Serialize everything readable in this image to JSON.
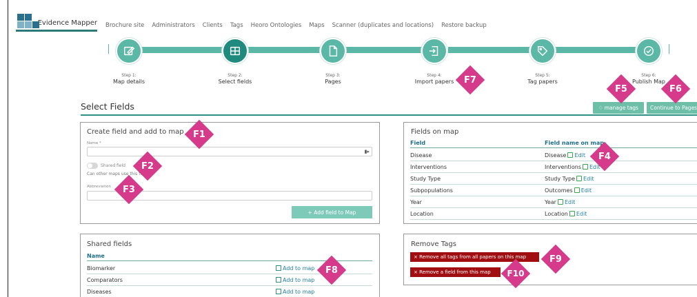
{
  "brand": {
    "name": "Evidence Mapper"
  },
  "nav": [
    "Brochure site",
    "Administrators",
    "Clients",
    "Tags",
    "Heoro Ontologies",
    "Maps",
    "Scanner (duplicates and locations)",
    "Restore backup"
  ],
  "steps": [
    {
      "num": "Step 1:",
      "label": "Map details",
      "icon": "edit-icon"
    },
    {
      "num": "Step 2:",
      "label": "Select fields",
      "icon": "grid-icon"
    },
    {
      "num": "Step 3:",
      "label": "Pages",
      "icon": "file-icon"
    },
    {
      "num": "Step 4:",
      "label": "Import papers",
      "icon": "import-icon"
    },
    {
      "num": "Step 5:",
      "label": "Tag papers",
      "icon": "tag-icon"
    },
    {
      "num": "Step 6:",
      "label": "Publish Map",
      "icon": "check-icon"
    }
  ],
  "page": {
    "title": "Select Fields",
    "manage_tags": "manage tags",
    "continue": "Continue to Pages"
  },
  "create_field": {
    "title": "Create field and add to map",
    "name_label": "Name *",
    "shared_label": "Shared field",
    "shared_help": "Can other maps use this field?",
    "abbrev_label": "Abbreviation",
    "add_button": "+ Add field to Map"
  },
  "fields_on_map": {
    "title": "Fields on map",
    "headers": [
      "Field",
      "Field name on map"
    ],
    "edit_label": "Edit",
    "rows": [
      {
        "field": "Disease",
        "name": "Disease"
      },
      {
        "field": "Interventions",
        "name": "Interventions"
      },
      {
        "field": "Study Type",
        "name": "Study Type"
      },
      {
        "field": "Subpopulations",
        "name": "Outcomes"
      },
      {
        "field": "Year",
        "name": "Year"
      },
      {
        "field": "Location",
        "name": "Location"
      }
    ]
  },
  "shared_fields": {
    "title": "Shared fields",
    "header": "Name",
    "add_label": "Add to map",
    "rows": [
      "Biomarker",
      "Comparators",
      "Diseases"
    ]
  },
  "remove_tags": {
    "title": "Remove Tags",
    "remove_all": "× Remove all tags from all papers on this map",
    "remove_field": "× Remove a field from this map"
  },
  "annotations": [
    "F1",
    "F2",
    "F3",
    "F4",
    "F5",
    "F6",
    "F7",
    "F8",
    "F9",
    "F10"
  ],
  "colors": {
    "accent": "#5cb8a6",
    "accent_dark": "#1f8a7d",
    "badge": "#d63a8b",
    "danger": "#a10e12",
    "link": "#1f7fa5"
  }
}
